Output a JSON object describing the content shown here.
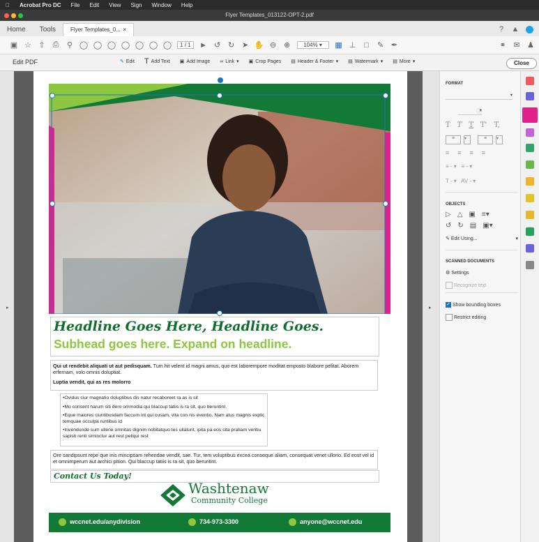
{
  "menubar": {
    "items": [
      "Acrobat Pro DC",
      "File",
      "Edit",
      "View",
      "Sign",
      "Window",
      "Help"
    ]
  },
  "window": {
    "title": "Flyer Templates_013122-OPT-2.pdf"
  },
  "tabs": {
    "home": "Home",
    "tools": "Tools",
    "doc": "Flyer Templates_0...",
    "close": "×"
  },
  "toolbar": {
    "page_current": "1",
    "page_total": "/ 1",
    "zoom": "104%"
  },
  "editbar": {
    "title": "Edit PDF",
    "edit": "Edit",
    "add_text": "Add Text",
    "add_image": "Add Image",
    "link": "Link",
    "crop": "Crop Pages",
    "header_footer": "Header & Footer",
    "watermark": "Watermark",
    "more": "More",
    "close": "Close"
  },
  "panel": {
    "format_title": "FORMAT",
    "objects_title": "OBJECTS",
    "edit_using": "Edit Using...",
    "scanned_title": "SCANNED DOCUMENTS",
    "settings": "Settings",
    "recognize": "Recognize text",
    "show_boxes": "Show bounding boxes",
    "restrict": "Restrict editing"
  },
  "flyer": {
    "headline": "Headline Goes Here, Headline Goes.",
    "subhead": "Subhead goes here. Expand on headline.",
    "para1_bold": "Qui ut rendebit aliquati ut aut pedisquam.",
    "para1": " Tum hit velent id magni amus, quo est laborempore moditat emposto blabore pelitat. Aborem erfernam, volo omnis doluptiat.",
    "subtitle": "Luptia vendit, qui as res molorro",
    "bullets": [
      "•Ovidus ciur magnatio doluptibus dis natur recaboreet ra as is sit",
      "•Mo consent harum siti dero ommodia qui blaccup tatiis is ra sit, quo beruntint.",
      "•Eque maiores ciuntibusdam faccum int qui cusam, vita con nis eventio. Nam atus magnis explic temquae occulpa runtibus id",
      "•Invendunde sum ullene omnitas dignim nobitatquo tes ullaturit, ipita pa eos sita pratiam veritiu sapisti renti siminctur aut rest peliqui rest"
    ],
    "para2": "Ore sandipsunt repe que inis mincipsam rehendae vendit, sae. Tur, tem voluptibus excea conseque aliam, consequat venet ullorio. Ed eost vel id et omnimperum aut archici pition. Qui blaccup tatiis is ra sit, quo beruntint.",
    "contact": "Contact Us Today!",
    "logo_name": "Washtenaw",
    "logo_sub": "Community College",
    "footer_web": "wccnet.edu/anydivision",
    "footer_phone": "734-973-3300",
    "footer_email": "anyone@wccnet.edu"
  },
  "colors": {
    "green_dark": "#127a36",
    "green_light": "#8dc63f",
    "magenta": "#e0218a",
    "selection": "#1f73c6"
  }
}
